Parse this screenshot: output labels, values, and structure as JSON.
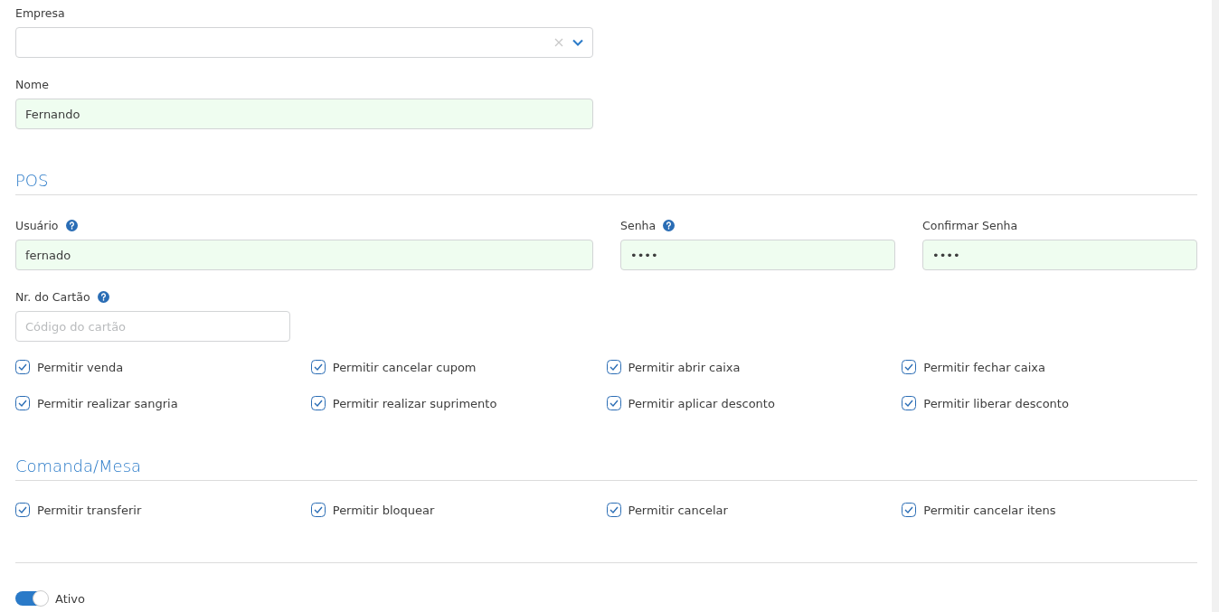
{
  "fields_top": [
    {
      "label": "Empresa",
      "kind": "select",
      "valid": false,
      "help": false
    },
    {
      "label": "Nome",
      "kind": "text",
      "value": "Fernando",
      "valid": true,
      "help": false
    }
  ],
  "pos": {
    "title": "POS",
    "credentials": [
      {
        "label": "Usuário",
        "value": "fernado",
        "valid": true,
        "help": true
      },
      {
        "label": "Senha",
        "value": "••••",
        "valid": true,
        "help": true
      },
      {
        "label": "Confirmar Senha",
        "value": "••••",
        "valid": true,
        "help": false
      }
    ],
    "card": {
      "label": "Nr. do Cartão",
      "placeholder": "Código do cartão",
      "valid": false,
      "help": true
    },
    "permissions": [
      {
        "label": "Permitir venda",
        "checked": true
      },
      {
        "label": "Permitir cancelar cupom",
        "checked": true
      },
      {
        "label": "Permitir abrir caixa",
        "checked": true
      },
      {
        "label": "Permitir fechar caixa",
        "checked": true
      },
      {
        "label": "Permitir realizar sangria",
        "checked": true
      },
      {
        "label": "Permitir realizar suprimento",
        "checked": true
      },
      {
        "label": "Permitir aplicar desconto",
        "checked": true
      },
      {
        "label": "Permitir liberar desconto",
        "checked": true
      }
    ]
  },
  "comanda": {
    "title": "Comanda/Mesa",
    "permissions": [
      {
        "label": "Permitir transferir",
        "checked": true
      },
      {
        "label": "Permitir bloquear",
        "checked": true
      },
      {
        "label": "Permitir cancelar",
        "checked": true
      },
      {
        "label": "Permitir cancelar itens",
        "checked": true
      }
    ]
  },
  "active": {
    "label": "Ativo",
    "on": true
  }
}
